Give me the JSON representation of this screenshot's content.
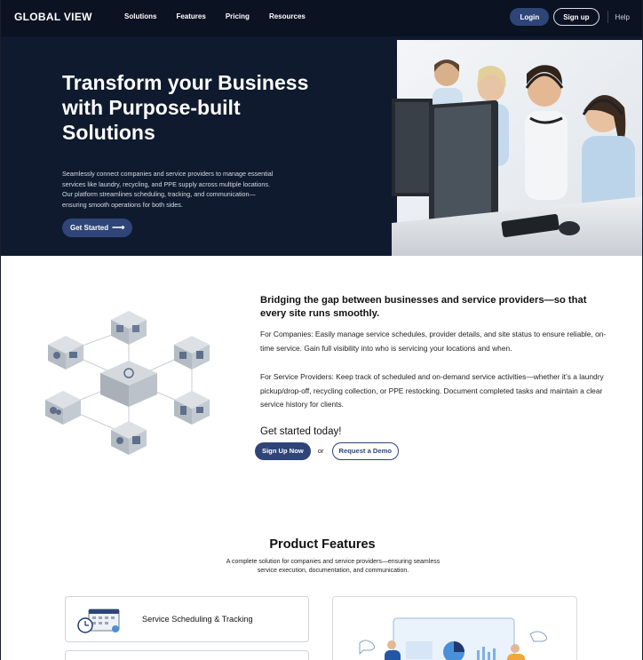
{
  "nav": {
    "logo": "GLOBAL VIEW",
    "links": [
      "Solutions",
      "Features",
      "Pricing",
      "Resources"
    ],
    "login": "Login",
    "signup": "Sign up",
    "help": "Help"
  },
  "hero": {
    "title": "Transform your Business with Purpose-built Solutions",
    "description": "Seamlessly connect companies and service providers to manage essential services like laundry, recycling, and PPE supply across multiple locations. Our platform streamlines scheduling, tracking, and communication—ensuring smooth operations for both sides.",
    "cta": "Get Started"
  },
  "bridge": {
    "title": "Bridging the gap between businesses and service providers—so that every site runs smoothly.",
    "companies": " For Companies: Easily manage service schedules, provider details, and site status to ensure reliable, on-time service. Gain full visibility into who is servicing your locations and when.",
    "providers": " For Service Providers: Keep track of scheduled and on-demand service activities—whether it’s a laundry pickup/drop-off, recycling collection, or PPE restocking. Document completed tasks and maintain a clear service history for clients.",
    "get_started": "Get started today!",
    "signup_now": "Sign Up Now",
    "or": "or",
    "demo": "Request a Demo"
  },
  "features": {
    "title": "Product Features",
    "subtitle": "A complete solution for companies and service providers—ensuring seamless service execution, documentation, and communication.",
    "items": [
      {
        "label": "Service Scheduling & Tracking",
        "icon": "calendar-scheduling-icon"
      }
    ]
  },
  "colors": {
    "nav_bg": "#0b1222",
    "hero_bg": "#0f1a2e",
    "accent": "#2f4578"
  }
}
